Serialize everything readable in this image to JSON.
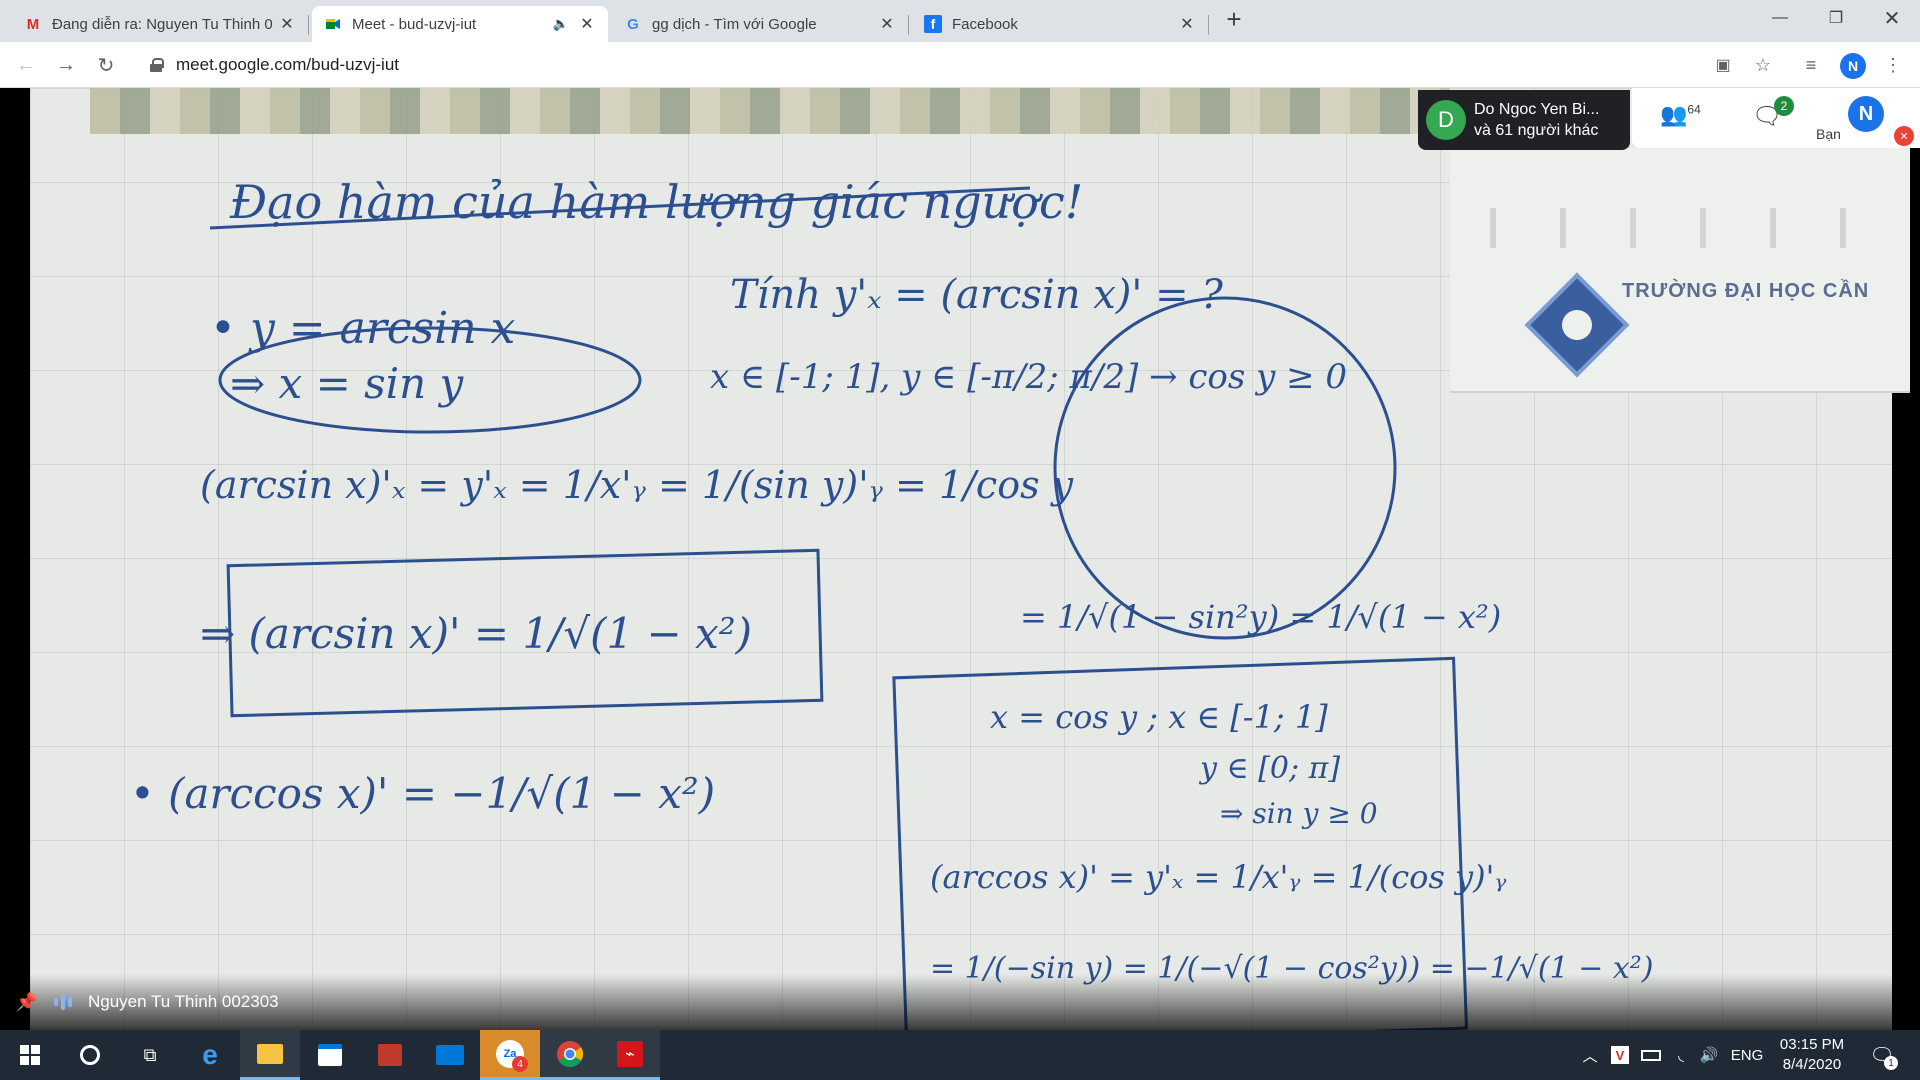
{
  "browser": {
    "tabs": [
      {
        "title": "Đang diễn ra: Nguyen Tu Thinh 0",
        "favicon": "gmail-icon",
        "active": false
      },
      {
        "title": "Meet - bud-uzvj-iut",
        "favicon": "meet-icon",
        "active": true,
        "audio": true
      },
      {
        "title": "gg dịch - Tìm với Google",
        "favicon": "google-icon",
        "active": false
      },
      {
        "title": "Facebook",
        "favicon": "facebook-icon",
        "active": false
      }
    ],
    "new_tab": "+",
    "url": "meet.google.com/bud-uzvj-iut",
    "profile_initial": "N"
  },
  "meet": {
    "participant_name": "Do Ngoc Yen Bi...",
    "participant_others": "và 61 người khác",
    "participant_initial": "D",
    "people_count": "64",
    "chat_badge": "2",
    "you_label": "Bạn",
    "you_initial": "N",
    "speaker_name": "Nguyen Tu Thinh 002303"
  },
  "board": {
    "school_name": "TRƯỜNG ĐẠI HỌC CẦN",
    "title": "Đạo hàm của hàm lượng giác ngược!",
    "lines": [
      "• y = arcsin x",
      "Tính y'ₓ = (arcsin x)' = ?",
      "x ∈ [-1; 1], y ∈ [-π/2; π/2] → cos y ≥ 0",
      "⇒ x = sin y",
      "(arcsin x)'ₓ = y'ₓ = 1/x'ᵧ = 1/(sin y)'ᵧ = 1/cos y",
      "= 1/√(1 − sin²y) = 1/√(1 − x²)",
      "⇒ (arcsin x)' = 1/√(1 − x²)",
      "• (arccos x)' = −1/√(1 − x²)",
      "x = cos y ; x ∈ [-1; 1]",
      "y ∈ [0; π]",
      "⇒ sin y ≥ 0",
      "(arccos x)' = y'ₓ = 1/x'ᵧ = 1/(cos y)'ᵧ",
      "= 1/(−sin y) = 1/(−√(1 − cos²y)) = −1/√(1 − x²)"
    ]
  },
  "taskbar": {
    "apps": [
      "windows-start-icon",
      "cortana-icon",
      "task-view-icon",
      "edge-icon",
      "file-explorer-icon",
      "store-icon",
      "snip-icon",
      "mail-icon",
      "zalo-icon",
      "chrome-icon",
      "acrobat-icon"
    ],
    "zalo_badge": "4",
    "language": "ENG",
    "time": "03:15 PM",
    "date": "8/4/2020",
    "notification_count": "1"
  }
}
